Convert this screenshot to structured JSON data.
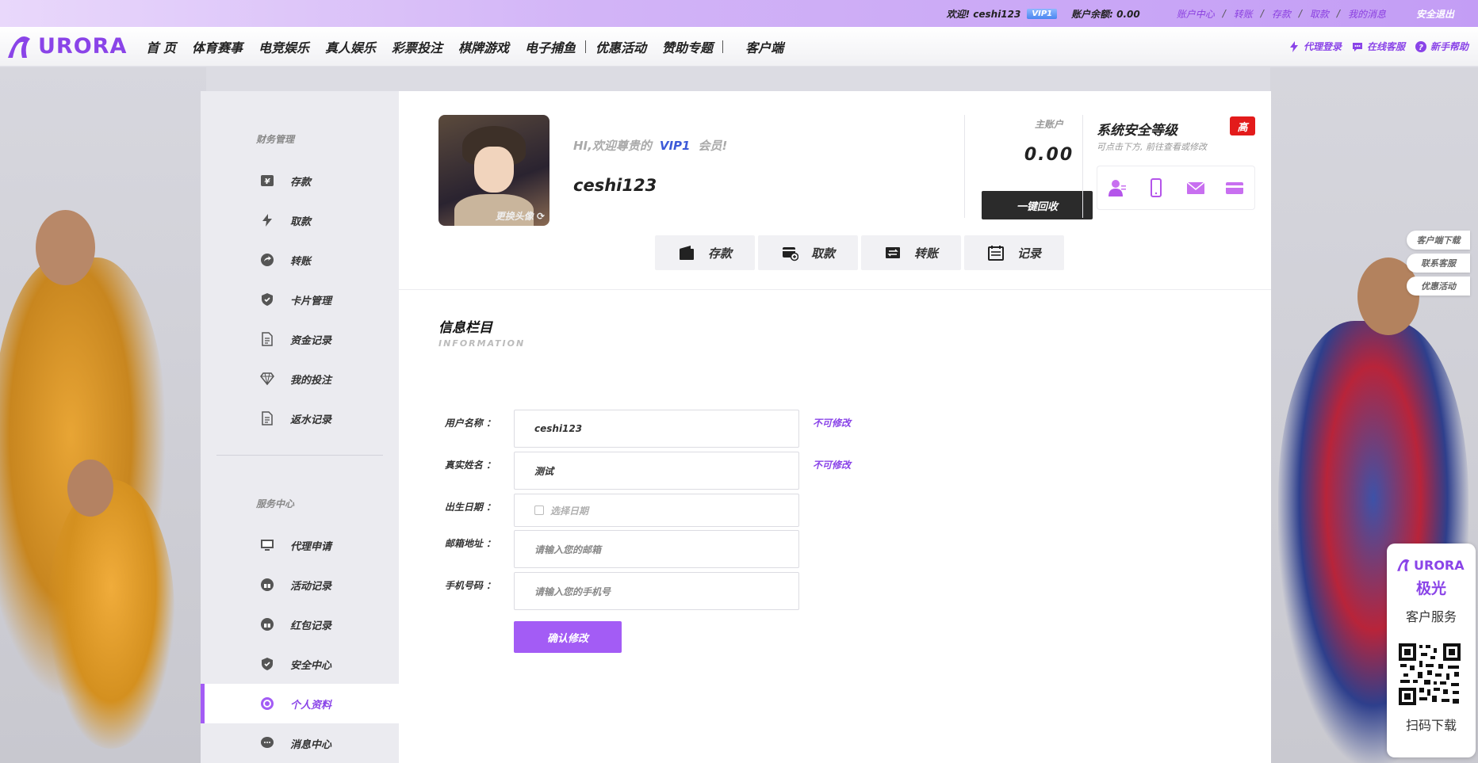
{
  "topbar": {
    "greeting": "欢迎! ceshi123",
    "vip": "VIP1",
    "balance": "账户余额: 0.00",
    "links": [
      "账户中心",
      "转账",
      "存款",
      "取款",
      "我的消息"
    ],
    "logout": "安全退出"
  },
  "navbar": {
    "logo_text": "URORA",
    "items": [
      "首 页",
      "体育赛事",
      "电竞娱乐",
      "真人娱乐",
      "彩票投注",
      "棋牌游戏",
      "电子捕鱼",
      "优惠活动",
      "赞助专题",
      "客户端"
    ],
    "right": [
      "代理登录",
      "在线客服",
      "新手帮助"
    ]
  },
  "sidebar": {
    "finance_title": "财务管理",
    "finance_items": [
      "存款",
      "取款",
      "转账",
      "卡片管理",
      "资金记录",
      "我的投注",
      "返水记录"
    ],
    "service_title": "服务中心",
    "service_items": [
      "代理申请",
      "活动记录",
      "红包记录",
      "安全中心",
      "个人资料",
      "消息中心"
    ],
    "active": "个人资料"
  },
  "profile": {
    "avatar_change": "更换头像",
    "welcome_prefix": "HI,欢迎尊贵的",
    "welcome_vip": "VIP1",
    "welcome_suffix": "会员!",
    "username": "ceshi123",
    "account_label": "主账户",
    "account_amount": "0.00",
    "recover_button": "一键回收",
    "security_title": "系统安全等级",
    "security_level": "高",
    "security_hint": "可点击下方, 前往查看或修改",
    "security_icons": [
      "user-icon",
      "phone-icon",
      "mail-icon",
      "card-icon"
    ]
  },
  "actions": [
    "存款",
    "取款",
    "转账",
    "记录"
  ],
  "info": {
    "title": "信息栏目",
    "subtitle": "INFORMATION",
    "fields": [
      {
        "label": "用户名称 ：",
        "value": "ceshi123",
        "note": "不可修改"
      },
      {
        "label": "真实姓名 ：",
        "value": "测试",
        "note": "不可修改"
      },
      {
        "label": "出生日期 ：",
        "placeholder": "选择日期"
      },
      {
        "label": "邮箱地址 ：",
        "placeholder": "请输入您的邮箱"
      },
      {
        "label": "手机号码 ：",
        "placeholder": "请输入您的手机号"
      }
    ],
    "confirm_button": "确认修改"
  },
  "float_links": [
    "客户端下载",
    "联系客服",
    "优惠活动"
  ],
  "qr_panel": {
    "logo": "URORA",
    "brand": "极光",
    "service": "客户服务",
    "scan": "扫码下载"
  },
  "colors": {
    "accent": "#8a44e8",
    "accent_button": "#a35cf5",
    "danger": "#e31b1b",
    "dark_button": "#2b2b2b"
  }
}
